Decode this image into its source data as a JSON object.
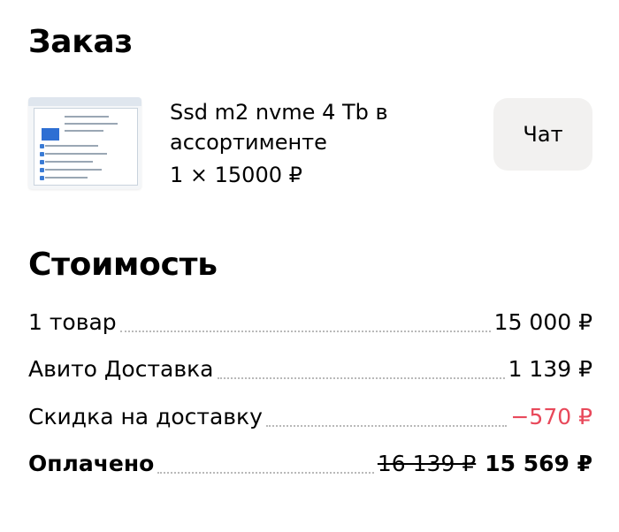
{
  "order": {
    "title": "Заказ",
    "item": {
      "name": "Ssd m2 nvme 4 Tb в ассортименте",
      "quantity_price": "1 × 15000 ₽"
    },
    "chat_label": "Чат"
  },
  "cost": {
    "title": "Стоимость",
    "rows": [
      {
        "label": "1 товар",
        "value": "15 000 ₽"
      },
      {
        "label": "Авито Доставка",
        "value": "1 139 ₽"
      },
      {
        "label": "Скидка на доставку",
        "value": "−570 ₽"
      },
      {
        "label": "Оплачено",
        "old_value": "16 139 ₽",
        "value": "15 569 ₽"
      }
    ]
  },
  "colors": {
    "discount": "#e8485a",
    "chat_button_bg": "#f2f1f0"
  }
}
